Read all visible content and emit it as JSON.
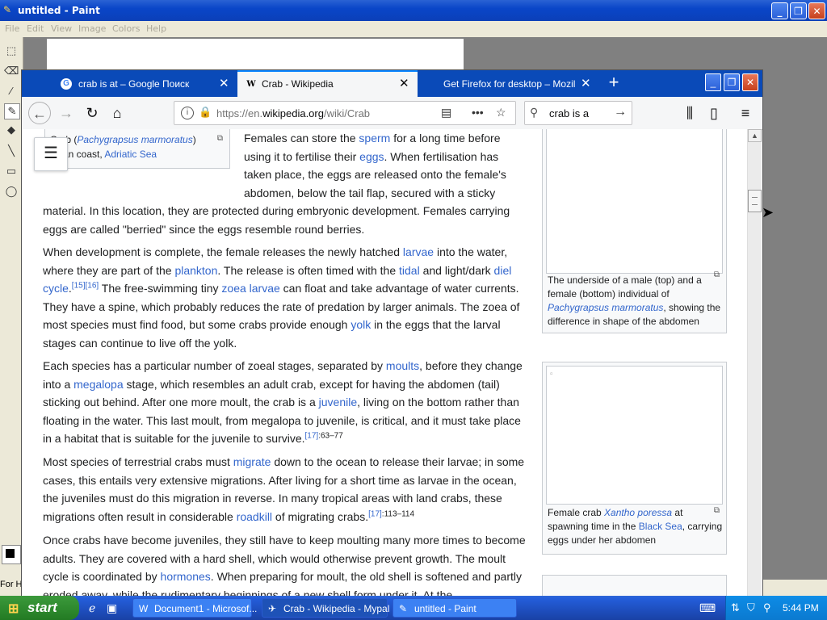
{
  "paint": {
    "title": "untitled - Paint",
    "menu": [
      "File",
      "Edit",
      "View",
      "Image",
      "Colors",
      "Help"
    ],
    "status_left": "For H"
  },
  "firefox": {
    "tabs": [
      {
        "label": "crab is at – Google Поиск",
        "favicon": "G"
      },
      {
        "label": "Crab - Wikipedia",
        "favicon": "W",
        "active": true
      },
      {
        "label": "Get Firefox for desktop – Mozilla (U",
        "favicon": "firefox-icon"
      }
    ],
    "url_host_prefix": "https://en.",
    "url_host": "wikipedia.org",
    "url_path": "/wiki/Crab",
    "search_query": "crab is a"
  },
  "article": {
    "top_caption": {
      "pre": "Crab (",
      "species": "Pachygrapsus marmoratus",
      "post": ")",
      "line2_pre": "strian coast, ",
      "line2_link": "Adriatic Sea"
    },
    "p1": {
      "t1": "Females can store the ",
      "a1": "sperm",
      "t2": " for a long time before",
      "t3": "using it to fertilise their ",
      "a2": "eggs",
      "t4": ". When fertilisation has",
      "t5": "taken place, the eggs are released onto the female's",
      "t6": "abdomen, below the tail flap, secured with a sticky",
      "t7": "material. In this location, they are protected during embryonic development. Females carrying eggs are called \"berried\" since the eggs resemble round berries."
    },
    "p2": {
      "t1": "When development is complete, the female releases the newly hatched ",
      "a1": "larvae",
      "t2": " into the water, where they are part of the ",
      "a2": "plankton",
      "t3": ". The release is often timed with the ",
      "a3": "tidal",
      "t4": " and light/dark ",
      "a4": "diel cycle",
      "s1": "[15]",
      "s2": "[16]",
      "t5": " The free-swimming tiny ",
      "a5": "zoea larvae",
      "t6": " can float and take advantage of water currents. They have a spine, which probably reduces the rate of predation by larger animals. The zoea of most species must find food, but some crabs provide enough ",
      "a6": "yolk",
      "t7": " in the eggs that the larval stages can continue to live off the yolk."
    },
    "p3": {
      "t1": "Each species has a particular number of zoeal stages, separated by ",
      "a1": "moults",
      "t2": ", before they change into a ",
      "a2": "megalopa",
      "t3": " stage, which resembles an adult crab, except for having the abdomen (tail) sticking out behind. After one more moult, the crab is a ",
      "a3": "juvenile",
      "t4": ", living on the bottom rather than floating in the water. This last moult, from megalopa to juvenile, is critical, and it must take place in a habitat that is suitable for the juvenile to survive.",
      "s1": "[17]",
      "s1b": ":63–77"
    },
    "p4": {
      "t1": "Most species of terrestrial crabs must ",
      "a1": "migrate",
      "t2": " down to the ocean to release their larvae; in some cases, this entails very extensive migrations. After living for a short time as larvae in the ocean, the juveniles must do this migration in reverse. In many tropical areas with land crabs, these migrations often result in considerable ",
      "a2": "roadkill",
      "t3": " of migrating crabs.",
      "s1": "[17]",
      "s1b": ":113–114"
    },
    "p5": {
      "t1": "Once crabs have become juveniles, they still have to keep moulting many more times to become adults. They are covered with a hard shell, which would otherwise prevent growth. The moult cycle is coordinated by ",
      "a1": "hormones",
      "t2": ". When preparing for moult, the old shell is softened and partly eroded away, while the rudimentary beginnings of a new shell form under it. At the"
    },
    "thumb1": {
      "c1": "The underside of a male (top) and a female (bottom) individual of ",
      "a1": "Pachygrapsus marmoratus",
      "c2": ", showing the difference in shape of the abdomen"
    },
    "thumb2": {
      "c1": "Female crab ",
      "a1": "Xantho poressa",
      "c2": " at spawning time in the ",
      "a2": "Black Sea",
      "c3": ", carrying eggs under her abdomen"
    }
  },
  "taskbar": {
    "start_label": "start",
    "tasks": [
      {
        "label": "Document1 - Microsof..."
      },
      {
        "label": "Crab - Wikipedia - Mypal",
        "active": true
      },
      {
        "label": "untitled - Paint"
      }
    ],
    "clock": "5:44 PM"
  }
}
